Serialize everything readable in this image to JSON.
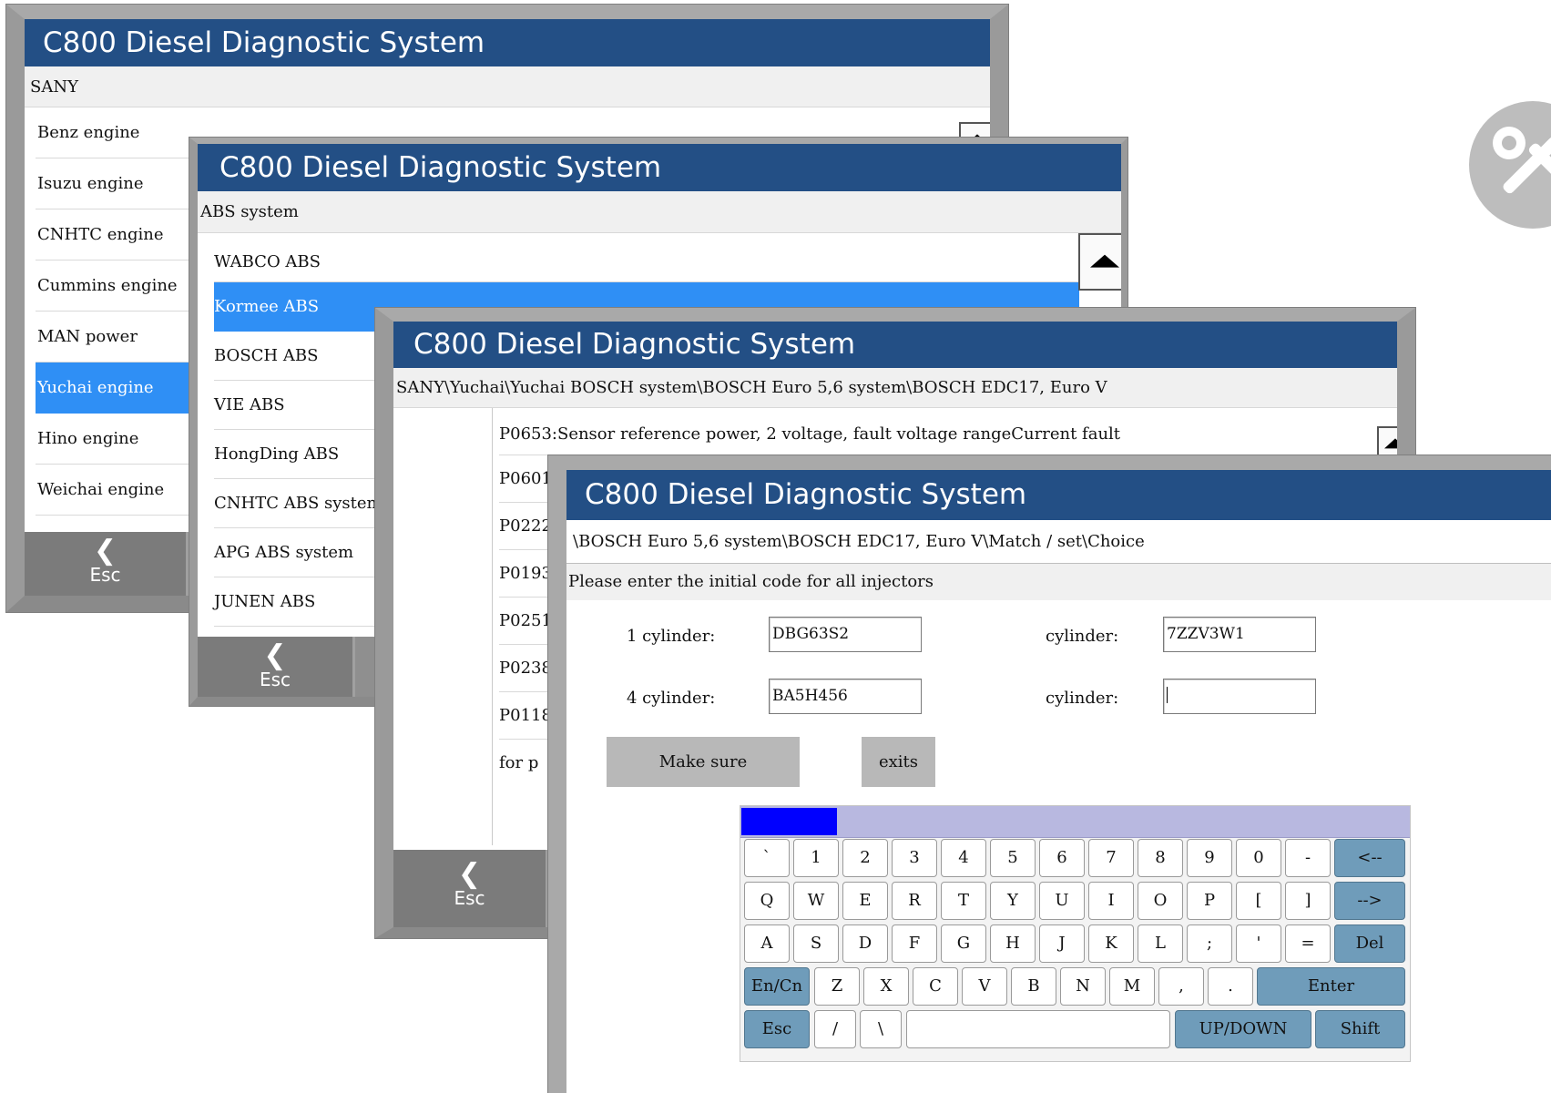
{
  "app_title": "C800 Diesel Diagnostic System",
  "win1": {
    "breadcrumb": "SANY",
    "items": [
      "Benz engine",
      "Isuzu engine",
      "CNHTC engine",
      "Cummins engine",
      "MAN power",
      "Yuchai engine",
      "Hino engine",
      "Weichai engine"
    ],
    "selected_index": 5,
    "esc_label": "Esc"
  },
  "win2": {
    "breadcrumb": "ABS system",
    "items": [
      "WABCO ABS",
      "Kormee ABS",
      "BOSCH ABS",
      "VIE ABS",
      "HongDing ABS",
      "CNHTC ABS system",
      "APG ABS system",
      "JUNEN ABS"
    ],
    "selected_index": 1,
    "esc_label": "Esc"
  },
  "win3": {
    "breadcrumb": "SANY\\Yuchai\\Yuchai BOSCH system\\BOSCH Euro 5,6 system\\BOSCH EDC17, Euro V",
    "codes": [
      "P0653:Sensor reference power, 2 voltage, fault voltage rangeCurrent fault",
      "P0601",
      "P0222",
      "P0193",
      "P0251",
      "P0238",
      "P0118",
      "for p"
    ],
    "esc_label": "Esc"
  },
  "win4": {
    "breadcrumb": "\\BOSCH Euro 5,6 system\\BOSCH EDC17, Euro V\\Match / set\\Choice",
    "prompt": "Please enter the initial code for all injectors",
    "fields": [
      {
        "label": "1 cylinder:",
        "value": "DBG63S2"
      },
      {
        "label": "cylinder:",
        "value": "7ZZV3W1"
      },
      {
        "label": "4 cylinder:",
        "value": "BA5H456"
      },
      {
        "label": "cylinder:",
        "value": ""
      }
    ],
    "make_sure_label": "Make sure",
    "exits_label": "exits"
  },
  "keyboard": {
    "row1": [
      "`",
      "1",
      "2",
      "3",
      "4",
      "5",
      "6",
      "7",
      "8",
      "9",
      "0",
      "-",
      "<--"
    ],
    "row2": [
      "Q",
      "W",
      "E",
      "R",
      "T",
      "Y",
      "U",
      "I",
      "O",
      "P",
      "[",
      "]",
      "-->"
    ],
    "row3": [
      "A",
      "S",
      "D",
      "F",
      "G",
      "H",
      "J",
      "K",
      "L",
      ";",
      "'",
      "=",
      "Del"
    ],
    "row4": [
      "En/Cn",
      "Z",
      "X",
      "C",
      "V",
      "B",
      "N",
      "M",
      ",",
      ".",
      "Enter"
    ],
    "row5": [
      "Esc",
      "/",
      "\\",
      "",
      "UP/DOWN",
      "Shift"
    ]
  },
  "colors": {
    "titlebar": "#234f85",
    "selection": "#2f8ff5",
    "function_key": "#6f9cba",
    "keyboard_indicator": "#0000ff",
    "keyboard_strip": "#b8b8e0"
  },
  "icons": [
    "chevron-left-icon",
    "scroll-up-icon",
    "wrench-screwdriver-icon"
  ]
}
